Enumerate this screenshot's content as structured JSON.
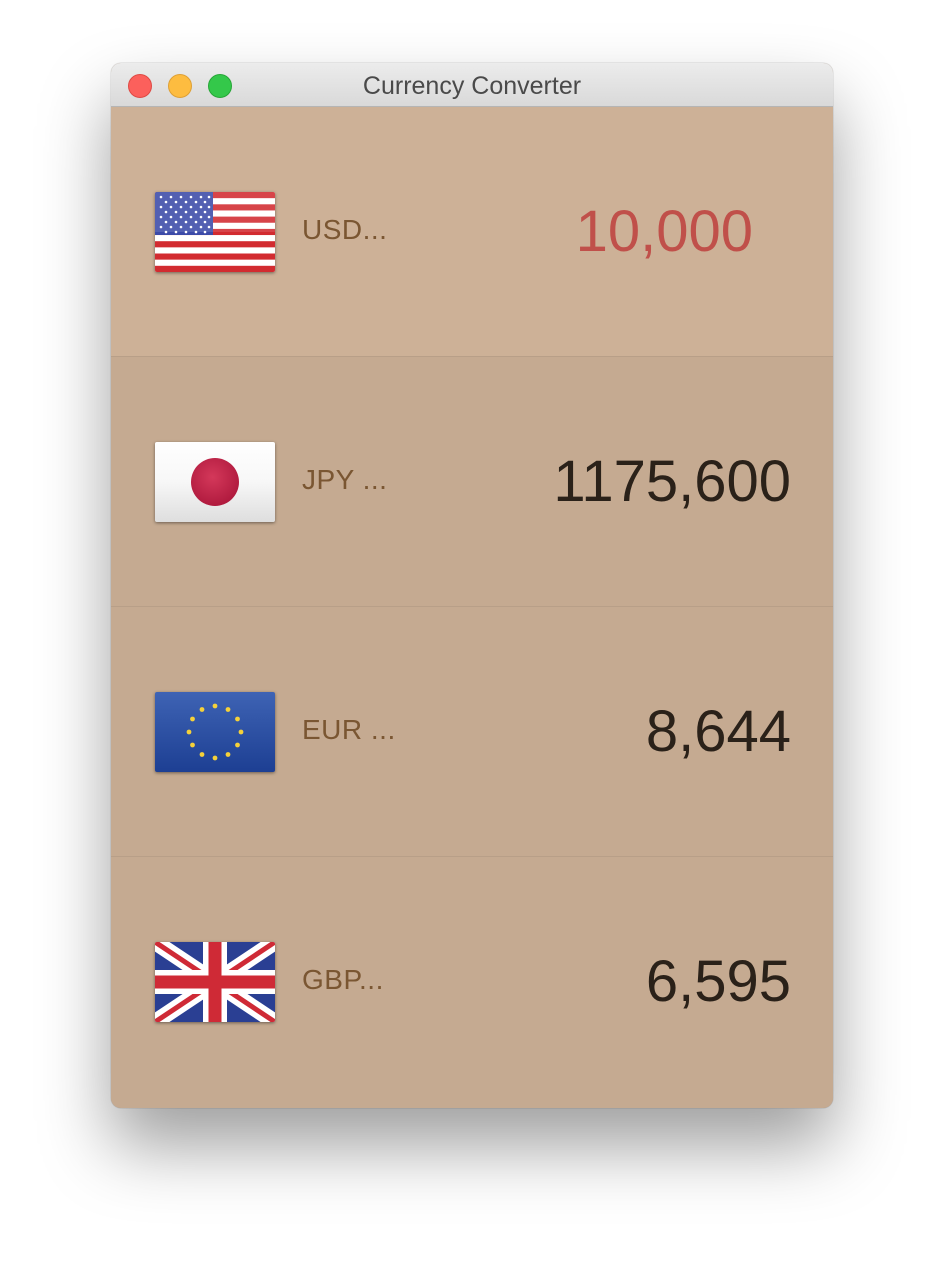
{
  "window": {
    "title": "Currency Converter"
  },
  "rows": [
    {
      "code_label": "USD...",
      "amount": "10,000",
      "flag_icon": "us-flag-icon",
      "active": true,
      "amount_color": "#c0504a"
    },
    {
      "code_label": "JPY ...",
      "amount": "1175,600",
      "flag_icon": "japan-flag-icon",
      "active": false
    },
    {
      "code_label": "EUR ...",
      "amount": "8,644",
      "flag_icon": "eu-flag-icon",
      "active": false
    },
    {
      "code_label": "GBP...",
      "amount": "6,595",
      "flag_icon": "uk-flag-icon",
      "active": false
    }
  ],
  "colors": {
    "background": "#c5aa91",
    "active_background": "#cdb197",
    "label": "#7a5632",
    "amount": "#2a2119",
    "active_amount": "#c0504a"
  }
}
